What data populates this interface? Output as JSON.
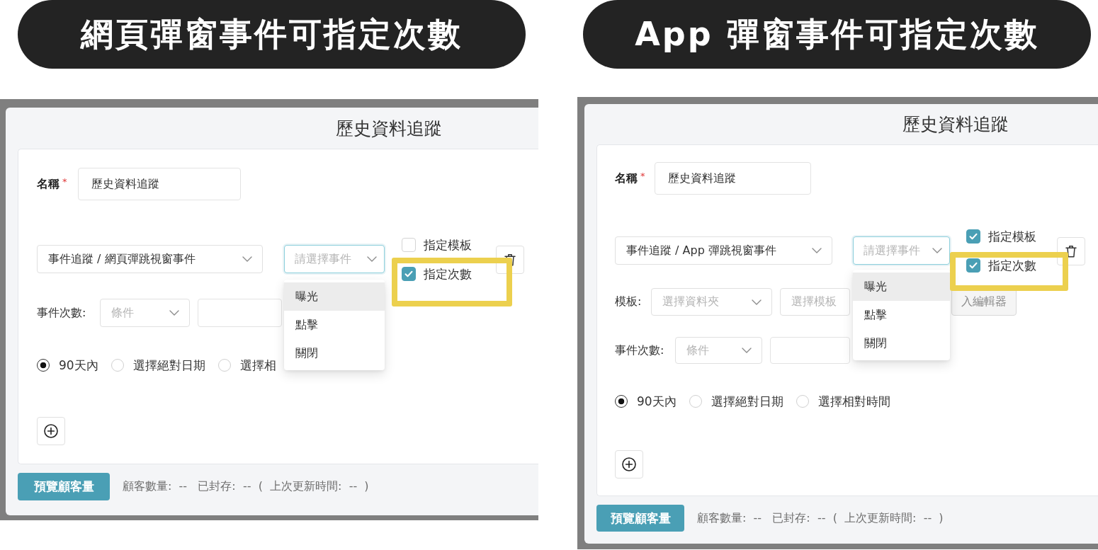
{
  "panels": [
    {
      "heading": "網頁彈窗事件可指定次數",
      "dialog": {
        "title": "歷史資料追蹤",
        "name_field": {
          "label": "名稱",
          "required_mark": "*",
          "value": "歷史資料追蹤"
        },
        "event_source": {
          "value": "事件追蹤 / 網頁彈跳視窗事件"
        },
        "event_picker": {
          "placeholder": "請選擇事件",
          "focused": true,
          "options": [
            {
              "label": "曝光",
              "selected": true
            },
            {
              "label": "點擊",
              "selected": false
            },
            {
              "label": "關閉",
              "selected": false
            }
          ]
        },
        "options": [
          {
            "label": "指定模板",
            "checked": false,
            "highlighted": false
          },
          {
            "label": "指定次數",
            "checked": true,
            "highlighted": true
          }
        ],
        "count_row": {
          "label": "事件次數:",
          "condition": {
            "placeholder": "條件"
          }
        },
        "date_range": [
          {
            "label": "90天內",
            "selected": true
          },
          {
            "label": "選擇絕對日期",
            "selected": false
          },
          {
            "label": "選擇相",
            "selected": false
          }
        ],
        "preview_button": "預覽顧客量",
        "status": "顧客數量:  --   已封存:  --  (  上次更新時間:  --  )"
      }
    },
    {
      "heading": "App 彈窗事件可指定次數",
      "dialog": {
        "title": "歷史資料追蹤",
        "name_field": {
          "label": "名稱",
          "required_mark": "*",
          "value": "歷史資料追蹤"
        },
        "event_source": {
          "value": "事件追蹤 / App 彈跳視窗事件"
        },
        "event_picker": {
          "placeholder": "請選擇事件",
          "focused": true,
          "options": [
            {
              "label": "曝光",
              "selected": true
            },
            {
              "label": "點擊",
              "selected": false
            },
            {
              "label": "關閉",
              "selected": false
            }
          ]
        },
        "options": [
          {
            "label": "指定模板",
            "checked": true,
            "highlighted": false
          },
          {
            "label": "指定次數",
            "checked": true,
            "highlighted": true
          }
        ],
        "template_row": {
          "label": "模板:",
          "folder": {
            "placeholder": "選擇資料夾"
          },
          "template": {
            "placeholder": "選擇模板"
          },
          "editor_button": {
            "label": "入編輯器",
            "disabled": true
          }
        },
        "count_row": {
          "label": "事件次數:",
          "condition": {
            "placeholder": "條件"
          }
        },
        "date_range": [
          {
            "label": "90天內",
            "selected": true
          },
          {
            "label": "選擇絕對日期",
            "selected": false
          },
          {
            "label": "選擇相對時間",
            "selected": false
          }
        ],
        "preview_button": "預覽顧客量",
        "status": "顧客數量:  --   已封存:  --  (  上次更新時間:  --  )"
      }
    }
  ]
}
